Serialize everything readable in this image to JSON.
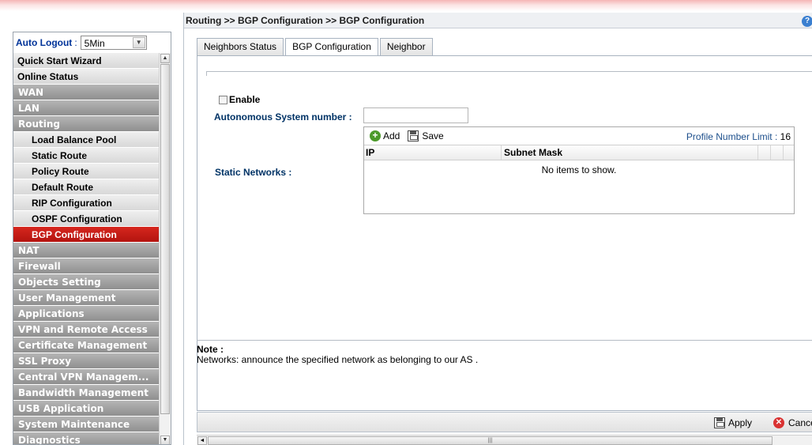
{
  "breadcrumb": "Routing >> BGP Configuration >> BGP Configuration",
  "help_icon": "?",
  "sidebar": {
    "auto_logout_label": "Auto Logout",
    "auto_logout_colon": ":",
    "auto_logout_value": "5Min",
    "items": [
      {
        "label": "Quick Start Wizard",
        "style": "light"
      },
      {
        "label": "Online Status",
        "style": "light"
      },
      {
        "label": "WAN",
        "style": "dark"
      },
      {
        "label": "LAN",
        "style": "dark"
      },
      {
        "label": "Routing",
        "style": "dark"
      },
      {
        "label": "Load Balance Pool",
        "style": "sub"
      },
      {
        "label": "Static Route",
        "style": "sub"
      },
      {
        "label": "Policy Route",
        "style": "sub"
      },
      {
        "label": "Default Route",
        "style": "sub"
      },
      {
        "label": "RIP Configuration",
        "style": "sub"
      },
      {
        "label": "OSPF Configuration",
        "style": "sub"
      },
      {
        "label": "BGP Configuration",
        "style": "active"
      },
      {
        "label": "NAT",
        "style": "dark"
      },
      {
        "label": "Firewall",
        "style": "dark"
      },
      {
        "label": "Objects Setting",
        "style": "dark"
      },
      {
        "label": "User Management",
        "style": "dark"
      },
      {
        "label": "Applications",
        "style": "dark"
      },
      {
        "label": "VPN and Remote Access",
        "style": "dark"
      },
      {
        "label": "Certificate Management",
        "style": "dark"
      },
      {
        "label": "SSL Proxy",
        "style": "dark"
      },
      {
        "label": "Central VPN Managem...",
        "style": "dark"
      },
      {
        "label": "Bandwidth Management",
        "style": "dark"
      },
      {
        "label": "USB Application",
        "style": "dark"
      },
      {
        "label": "System Maintenance",
        "style": "dark"
      },
      {
        "label": "Diagnostics",
        "style": "dark"
      }
    ]
  },
  "tabs": [
    "Neighbors Status",
    "BGP Configuration",
    "Neighbor"
  ],
  "active_tab": 1,
  "form": {
    "enable_label": "Enable",
    "enable_checked": false,
    "asn_label": "Autonomous System number :",
    "asn_value": "",
    "static_networks_label": "Static Networks :"
  },
  "grid": {
    "add_label": "Add",
    "save_label": "Save",
    "limit_label": "Profile Number Limit :",
    "limit_value": "16",
    "columns": [
      "IP",
      "Subnet Mask"
    ],
    "empty_text": "No items to show."
  },
  "note": {
    "title": "Note :",
    "body": "Networks: announce the specified network as belonging to our AS ."
  },
  "footer": {
    "apply_label": "Apply",
    "cancel_label": "Cance"
  },
  "colors": {
    "active_menu": "#c11b15",
    "label_blue": "#003366",
    "dark_menu": "#a3a3a3"
  }
}
